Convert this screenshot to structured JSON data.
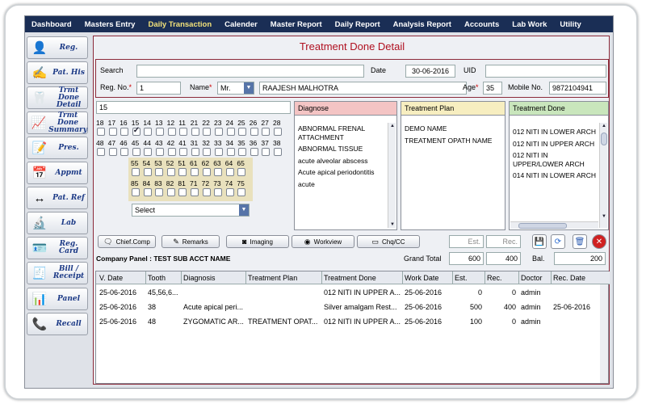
{
  "nav": [
    "Dashboard",
    "Masters Entry",
    "Daily Transaction",
    "Calender",
    "Master Report",
    "Daily Report",
    "Analysis Report",
    "Accounts",
    "Lab Work",
    "Utility"
  ],
  "nav_active": 2,
  "sidebar": [
    {
      "label": "Reg.",
      "icon": "registration-icon",
      "glyph": "👤"
    },
    {
      "label": "Pat. His",
      "icon": "patient-history-icon",
      "glyph": "✍"
    },
    {
      "label": "Trmt Done Detail",
      "icon": "treatment-detail-icon",
      "glyph": "🦷"
    },
    {
      "label": "Trmt Done Summary",
      "icon": "treatment-summary-icon",
      "glyph": "📈"
    },
    {
      "label": "Pres.",
      "icon": "prescription-icon",
      "glyph": "📝"
    },
    {
      "label": "Appmt",
      "icon": "appointment-icon",
      "glyph": "📅"
    },
    {
      "label": "Pat. Ref",
      "icon": "patient-referral-icon",
      "glyph": "↔"
    },
    {
      "label": "Lab",
      "icon": "lab-icon",
      "glyph": "🔬"
    },
    {
      "label": "Reg. Card",
      "icon": "registration-card-icon",
      "glyph": "🪪"
    },
    {
      "label": "Bill / Receipt",
      "icon": "bill-receipt-icon",
      "glyph": "🧾"
    },
    {
      "label": "Panel",
      "icon": "panel-icon",
      "glyph": "📊"
    },
    {
      "label": "Recall",
      "icon": "recall-icon",
      "glyph": "📞"
    }
  ],
  "title": "Treatment Done Detail",
  "form": {
    "search_label": "Search",
    "search_value": "",
    "date_label": "Date",
    "date_value": "30-06-2016",
    "uid_label": "UID",
    "uid_value": "",
    "regno_label": "Reg. No.",
    "regno_value": "1",
    "name_label": "Name",
    "salutation": "Mr.",
    "name_value": "RAAJESH MALHOTRA",
    "age_label": "Age",
    "age_value": "35",
    "mobile_label": "Mobile No.",
    "mobile_value": "9872104941"
  },
  "teeth": {
    "selected_text": "15",
    "upper_row": [
      "18",
      "17",
      "16",
      "15",
      "14",
      "13",
      "12",
      "11",
      "21",
      "22",
      "23",
      "24",
      "25",
      "26",
      "27",
      "28"
    ],
    "lower_row": [
      "48",
      "47",
      "46",
      "45",
      "44",
      "43",
      "42",
      "41",
      "31",
      "32",
      "33",
      "34",
      "35",
      "36",
      "37",
      "38"
    ],
    "primary_upper": [
      "55",
      "54",
      "53",
      "52",
      "51",
      "61",
      "62",
      "63",
      "64",
      "65"
    ],
    "primary_lower": [
      "85",
      "84",
      "83",
      "82",
      "81",
      "71",
      "72",
      "73",
      "74",
      "75"
    ],
    "checked": "15",
    "select_label": "Select"
  },
  "diagnose": {
    "header": "Diagnose",
    "items": [
      "ABNORMAL FRENAL ATTACHMENT",
      "ABNORMAL TISSUE",
      "acute alveolar abscess",
      "Acute apical periodontitis",
      "acute"
    ]
  },
  "plan": {
    "header": "Treatment Plan",
    "items": [
      "DEMO NAME",
      "TREATMENT OPATH NAME"
    ]
  },
  "done": {
    "header": "Treatment Done",
    "items": [
      "012 NITI IN LOWER ARCH",
      "012 NITI IN UPPER ARCH",
      "012 NITI IN UPPER/LOWER ARCH",
      "014 NITI IN LOWER ARCH"
    ]
  },
  "toolbar": {
    "chief": "Chief.Comp",
    "remarks": "Remarks",
    "imaging": "Imaging",
    "workview": "Workview",
    "chq": "Chq/CC",
    "est_placeholder": "Est.",
    "rec_placeholder": "Rec."
  },
  "summary": {
    "company_panel": "Company Panel : TEST SUB ACCT NAME",
    "grand_total_label": "Grand Total",
    "grand_total_est": "600",
    "grand_total_rec": "400",
    "bal_label": "Bal.",
    "bal_value": "200"
  },
  "table": {
    "columns": [
      "V. Date",
      "Tooth",
      "Diagnosis",
      "Treatment Plan",
      "Treatment Done",
      "Work Date",
      "Est.",
      "Rec.",
      "Doctor",
      "Rec. Date"
    ],
    "rows": [
      [
        "25-06-2016",
        "45,56,6...",
        "",
        "",
        "012 NITI IN UPPER A...",
        "25-06-2016",
        "0",
        "0",
        "admin",
        ""
      ],
      [
        "25-06-2016",
        "38",
        "Acute apical peri...",
        "",
        "Silver amalgam Rest...",
        "25-06-2016",
        "500",
        "400",
        "admin",
        "25-06-2016"
      ],
      [
        "25-06-2016",
        "48",
        "ZYGOMATIC AR...",
        "TREATMENT OPAT...",
        "012 NITI IN UPPER A...",
        "25-06-2016",
        "100",
        "0",
        "admin",
        ""
      ]
    ]
  },
  "colors": {
    "nav_bg": "#1a2e55",
    "accent": "#b01020",
    "diag_head": "#f4c4c4",
    "plan_head": "#f7eec0",
    "done_head": "#c9e6bc"
  }
}
